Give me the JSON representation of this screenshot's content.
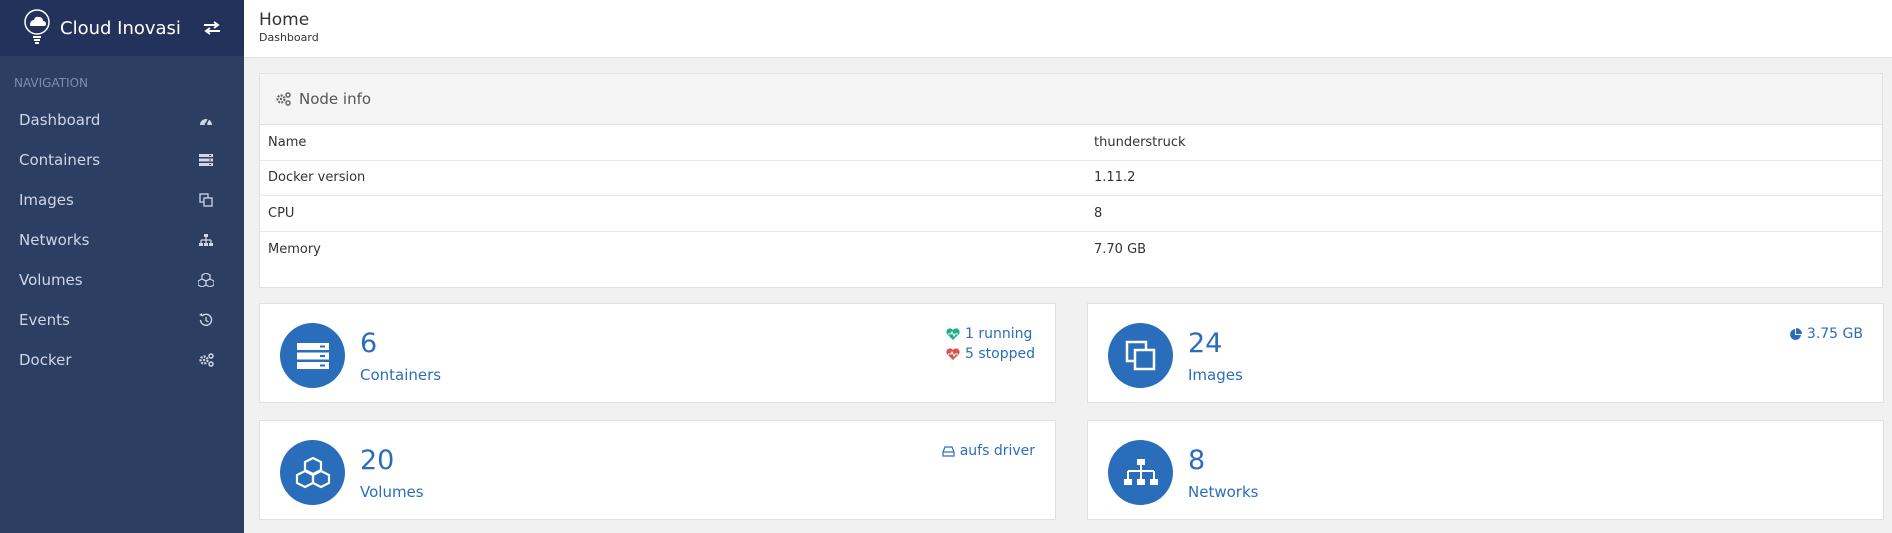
{
  "app": {
    "brand": "Cloud Inovasi"
  },
  "sidebar": {
    "nav_title": "NAVIGATION",
    "items": [
      {
        "label": "Dashboard",
        "icon": "dashboard-icon"
      },
      {
        "label": "Containers",
        "icon": "server-icon"
      },
      {
        "label": "Images",
        "icon": "clone-icon"
      },
      {
        "label": "Networks",
        "icon": "sitemap-icon"
      },
      {
        "label": "Volumes",
        "icon": "cubes-icon"
      },
      {
        "label": "Events",
        "icon": "history-icon"
      },
      {
        "label": "Docker",
        "icon": "cogs-icon"
      }
    ]
  },
  "header": {
    "title": "Home",
    "subtitle": "Dashboard"
  },
  "node_info": {
    "title": "Node info",
    "rows": [
      {
        "key": "Name",
        "value": "thunderstruck"
      },
      {
        "key": "Docker version",
        "value": "1.11.2"
      },
      {
        "key": "CPU",
        "value": "8"
      },
      {
        "key": "Memory",
        "value": "7.70 GB"
      }
    ]
  },
  "stats": {
    "containers": {
      "count": "6",
      "label": "Containers",
      "running": "1 running",
      "stopped": "5 stopped"
    },
    "images": {
      "count": "24",
      "label": "Images",
      "size": "3.75 GB"
    },
    "volumes": {
      "count": "20",
      "label": "Volumes",
      "driver": "aufs driver"
    },
    "networks": {
      "count": "8",
      "label": "Networks"
    }
  },
  "colors": {
    "sidebar": "#2d3e63",
    "accent": "#2a6ebb",
    "running": "#23ae89",
    "stopped": "#d9534f"
  }
}
